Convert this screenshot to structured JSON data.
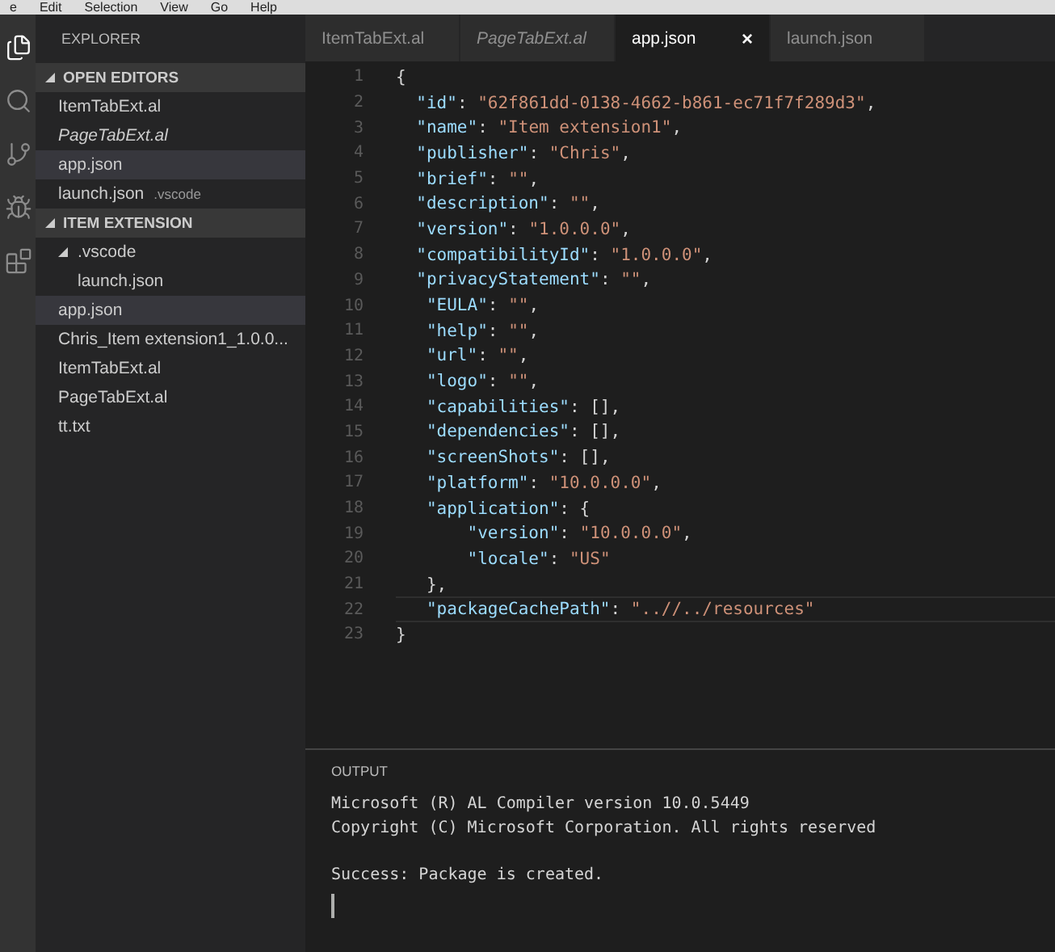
{
  "menu_bar": {
    "items": [
      "e",
      "Edit",
      "Selection",
      "View",
      "Go",
      "Help"
    ]
  },
  "activity_bar": {
    "items": [
      {
        "kind": "files",
        "selected": true
      },
      {
        "kind": "search",
        "selected": false
      },
      {
        "kind": "git",
        "selected": false
      },
      {
        "kind": "debug",
        "selected": false
      },
      {
        "kind": "extensions",
        "selected": false
      }
    ]
  },
  "sidebar": {
    "title": "EXPLORER",
    "sections": [
      {
        "title": "OPEN EDITORS",
        "expanded": true,
        "items": [
          {
            "label": "ItemTabExt.al",
            "preview": false,
            "selected": false
          },
          {
            "label": "PageTabExt.al",
            "preview": true,
            "selected": false
          },
          {
            "label": "app.json",
            "preview": false,
            "selected": true
          },
          {
            "label": "launch.json",
            "hint": ".vscode",
            "preview": false,
            "selected": false
          }
        ]
      },
      {
        "title": "ITEM EXTENSION",
        "expanded": true,
        "items": [
          {
            "label": ".vscode",
            "expanded": true,
            "selected": false,
            "children": [
              {
                "label": "launch.json",
                "selected": false
              }
            ]
          },
          {
            "label": "app.json",
            "selected": true
          },
          {
            "label": "Chris_Item extension1_1.0.0...",
            "selected": false
          },
          {
            "label": "ItemTabExt.al",
            "selected": false
          },
          {
            "label": "PageTabExt.al",
            "selected": false
          },
          {
            "label": "tt.txt",
            "selected": false
          }
        ]
      }
    ]
  },
  "tabs": [
    {
      "label": "ItemTabExt.al",
      "preview": false,
      "selected": false
    },
    {
      "label": "PageTabExt.al",
      "preview": true,
      "selected": false
    },
    {
      "label": "app.json",
      "preview": false,
      "selected": true,
      "close": "×"
    },
    {
      "label": "launch.json",
      "preview": false,
      "selected": false
    }
  ],
  "editor": {
    "lines": [
      {
        "number": "1",
        "current": false,
        "tokens": [
          {
            "kind": "punct",
            "text": "{"
          }
        ]
      },
      {
        "number": "2",
        "current": false,
        "tokens": [
          {
            "kind": "key",
            "text": "  \"id\""
          },
          {
            "kind": "punct",
            "text": ": "
          },
          {
            "kind": "string",
            "text": "\"62f861dd-0138-4662-b861-ec71f7f289d3\""
          },
          {
            "kind": "punct",
            "text": ","
          }
        ]
      },
      {
        "number": "3",
        "current": false,
        "tokens": [
          {
            "kind": "key",
            "text": "  \"name\""
          },
          {
            "kind": "punct",
            "text": ": "
          },
          {
            "kind": "string",
            "text": "\"Item extension1\""
          },
          {
            "kind": "punct",
            "text": ","
          }
        ]
      },
      {
        "number": "4",
        "current": false,
        "tokens": [
          {
            "kind": "key",
            "text": "  \"publisher\""
          },
          {
            "kind": "punct",
            "text": ": "
          },
          {
            "kind": "string",
            "text": "\"Chris\""
          },
          {
            "kind": "punct",
            "text": ","
          }
        ]
      },
      {
        "number": "5",
        "current": false,
        "tokens": [
          {
            "kind": "key",
            "text": "  \"brief\""
          },
          {
            "kind": "punct",
            "text": ": "
          },
          {
            "kind": "string",
            "text": "\"\""
          },
          {
            "kind": "punct",
            "text": ","
          }
        ]
      },
      {
        "number": "6",
        "current": false,
        "tokens": [
          {
            "kind": "key",
            "text": "  \"description\""
          },
          {
            "kind": "punct",
            "text": ": "
          },
          {
            "kind": "string",
            "text": "\"\""
          },
          {
            "kind": "punct",
            "text": ","
          }
        ]
      },
      {
        "number": "7",
        "current": false,
        "tokens": [
          {
            "kind": "key",
            "text": "  \"version\""
          },
          {
            "kind": "punct",
            "text": ": "
          },
          {
            "kind": "string",
            "text": "\"1.0.0.0\""
          },
          {
            "kind": "punct",
            "text": ","
          }
        ]
      },
      {
        "number": "8",
        "current": false,
        "tokens": [
          {
            "kind": "key",
            "text": "  \"compatibilityId\""
          },
          {
            "kind": "punct",
            "text": ": "
          },
          {
            "kind": "string",
            "text": "\"1.0.0.0\""
          },
          {
            "kind": "punct",
            "text": ","
          }
        ]
      },
      {
        "number": "9",
        "current": false,
        "tokens": [
          {
            "kind": "key",
            "text": "  \"privacyStatement\""
          },
          {
            "kind": "punct",
            "text": ": "
          },
          {
            "kind": "string",
            "text": "\"\""
          },
          {
            "kind": "punct",
            "text": ","
          }
        ]
      },
      {
        "number": "10",
        "current": false,
        "tokens": [
          {
            "kind": "key",
            "text": "   \"EULA\""
          },
          {
            "kind": "punct",
            "text": ": "
          },
          {
            "kind": "string",
            "text": "\"\""
          },
          {
            "kind": "punct",
            "text": ","
          }
        ]
      },
      {
        "number": "11",
        "current": false,
        "tokens": [
          {
            "kind": "key",
            "text": "   \"help\""
          },
          {
            "kind": "punct",
            "text": ": "
          },
          {
            "kind": "string",
            "text": "\"\""
          },
          {
            "kind": "punct",
            "text": ","
          }
        ]
      },
      {
        "number": "12",
        "current": false,
        "tokens": [
          {
            "kind": "key",
            "text": "   \"url\""
          },
          {
            "kind": "punct",
            "text": ": "
          },
          {
            "kind": "string",
            "text": "\"\""
          },
          {
            "kind": "punct",
            "text": ","
          }
        ]
      },
      {
        "number": "13",
        "current": false,
        "tokens": [
          {
            "kind": "key",
            "text": "   \"logo\""
          },
          {
            "kind": "punct",
            "text": ": "
          },
          {
            "kind": "string",
            "text": "\"\""
          },
          {
            "kind": "punct",
            "text": ","
          }
        ]
      },
      {
        "number": "14",
        "current": false,
        "tokens": [
          {
            "kind": "key",
            "text": "   \"capabilities\""
          },
          {
            "kind": "punct",
            "text": ": [],"
          }
        ]
      },
      {
        "number": "15",
        "current": false,
        "tokens": [
          {
            "kind": "key",
            "text": "   \"dependencies\""
          },
          {
            "kind": "punct",
            "text": ": [],"
          }
        ]
      },
      {
        "number": "16",
        "current": false,
        "tokens": [
          {
            "kind": "key",
            "text": "   \"screenShots\""
          },
          {
            "kind": "punct",
            "text": ": [],"
          }
        ]
      },
      {
        "number": "17",
        "current": false,
        "tokens": [
          {
            "kind": "key",
            "text": "   \"platform\""
          },
          {
            "kind": "punct",
            "text": ": "
          },
          {
            "kind": "string",
            "text": "\"10.0.0.0\""
          },
          {
            "kind": "punct",
            "text": ","
          }
        ]
      },
      {
        "number": "18",
        "current": false,
        "tokens": [
          {
            "kind": "key",
            "text": "   \"application\""
          },
          {
            "kind": "punct",
            "text": ": {"
          }
        ]
      },
      {
        "number": "19",
        "current": false,
        "tokens": [
          {
            "kind": "key",
            "text": "       \"version\""
          },
          {
            "kind": "punct",
            "text": ": "
          },
          {
            "kind": "string",
            "text": "\"10.0.0.0\""
          },
          {
            "kind": "punct",
            "text": ","
          }
        ]
      },
      {
        "number": "20",
        "current": false,
        "tokens": [
          {
            "kind": "key",
            "text": "       \"locale\""
          },
          {
            "kind": "punct",
            "text": ": "
          },
          {
            "kind": "string",
            "text": "\"US\""
          }
        ]
      },
      {
        "number": "21",
        "current": false,
        "tokens": [
          {
            "kind": "punct",
            "text": "   },"
          }
        ]
      },
      {
        "number": "22",
        "current": true,
        "tokens": [
          {
            "kind": "key",
            "text": "   \"packageCachePath\""
          },
          {
            "kind": "punct",
            "text": ": "
          },
          {
            "kind": "string",
            "text": "\"..//../resources\""
          }
        ]
      },
      {
        "number": "23",
        "current": false,
        "tokens": [
          {
            "kind": "punct",
            "text": "}"
          }
        ]
      }
    ]
  },
  "output": {
    "title": "OUTPUT",
    "lines": [
      {
        "text": "Microsoft (R) AL Compiler version 10.0.5449",
        "gap_before": false
      },
      {
        "text": "Copyright (C) Microsoft Corporation. All rights reserved",
        "gap_before": false
      },
      {
        "text": "Success: Package is created.",
        "gap_before": true
      }
    ],
    "cursor": true
  }
}
